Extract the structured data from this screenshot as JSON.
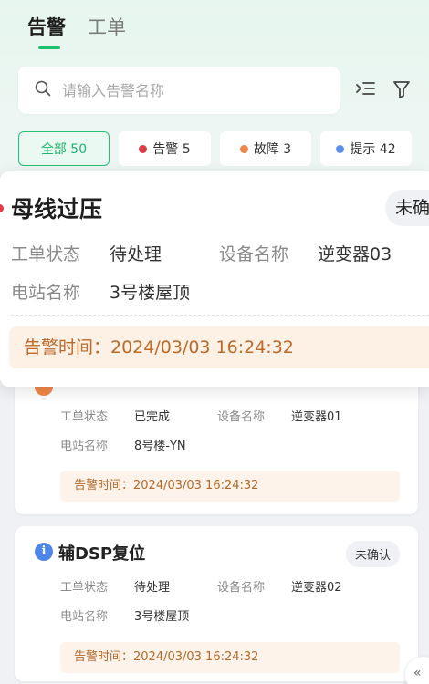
{
  "tabs": [
    {
      "label": "告警",
      "active": true
    },
    {
      "label": "工单",
      "active": false
    }
  ],
  "search": {
    "placeholder": "请输入告警名称",
    "icon": "search-icon"
  },
  "toolbar": {
    "list_icon": "list-filter-icon",
    "filter_icon": "funnel-icon"
  },
  "filters": [
    {
      "label": "全部 50",
      "active": true
    },
    {
      "label": "告警 5",
      "dot_color": "#e03a47"
    },
    {
      "label": "故障 3",
      "dot_color": "#f0874a"
    },
    {
      "label": "提示 42",
      "dot_color": "#5b8ef0"
    }
  ],
  "detail": {
    "title": "母线过压",
    "badge": "未确",
    "status_label": "工单状态",
    "status_value": "待处理",
    "device_label": "设备名称",
    "device_value": "逆变器03",
    "station_label": "电站名称",
    "station_value": "3号楼屋顶",
    "time": "告警时间：2024/03/03  16:24:32"
  },
  "cards": [
    {
      "title": "",
      "badge": "",
      "status_label": "工单状态",
      "status_value": "已完成",
      "device_label": "设备名称",
      "device_value": "逆变器01",
      "station_label": "电站名称",
      "station_value": "8号楼-YN",
      "time": "告警时间：2024/03/03  16:24:32"
    },
    {
      "title": "辅DSP复位",
      "badge": "未确认",
      "status_label": "工单状态",
      "status_value": "待处理",
      "device_label": "设备名称",
      "device_value": "逆变器02",
      "station_label": "电站名称",
      "station_value": "3号楼屋顶",
      "time": "告警时间：2024/03/03  16:24:32"
    }
  ],
  "colors": {
    "accent": "#19c06b",
    "alarm": "#e53947",
    "fault": "#f0874a",
    "info": "#4f86ea"
  }
}
